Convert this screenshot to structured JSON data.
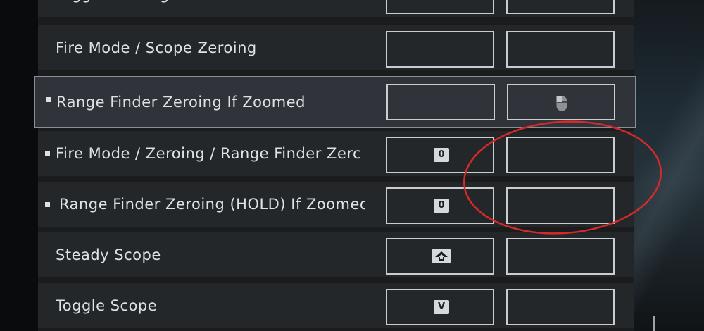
{
  "rows": [
    {
      "label": "Toggle Flashligh",
      "key1": "",
      "key2": ""
    },
    {
      "label": "Fire Mode / Scope Zeroing",
      "key1": "",
      "key2": ""
    },
    {
      "label": "Range Finder Zeroing If Zoomed",
      "key1": "",
      "key2": "mouse-icon"
    },
    {
      "label": "Fire Mode / Zeroing / Range Finder Zerc",
      "key1": "0",
      "key2": ""
    },
    {
      "label": "Range Finder Zeroing (HOLD) If Zoomed",
      "key1": "0",
      "key2": ""
    },
    {
      "label": "Steady Scope",
      "key1": "shift-arrow-icon",
      "key2": ""
    },
    {
      "label": "Toggle Scope",
      "key1": "V",
      "key2": ""
    }
  ],
  "selected_row": "Range Finder Zeroing If Zoomed",
  "annotation": {
    "shape": "red-ellipse",
    "color": "#d42a2a"
  }
}
